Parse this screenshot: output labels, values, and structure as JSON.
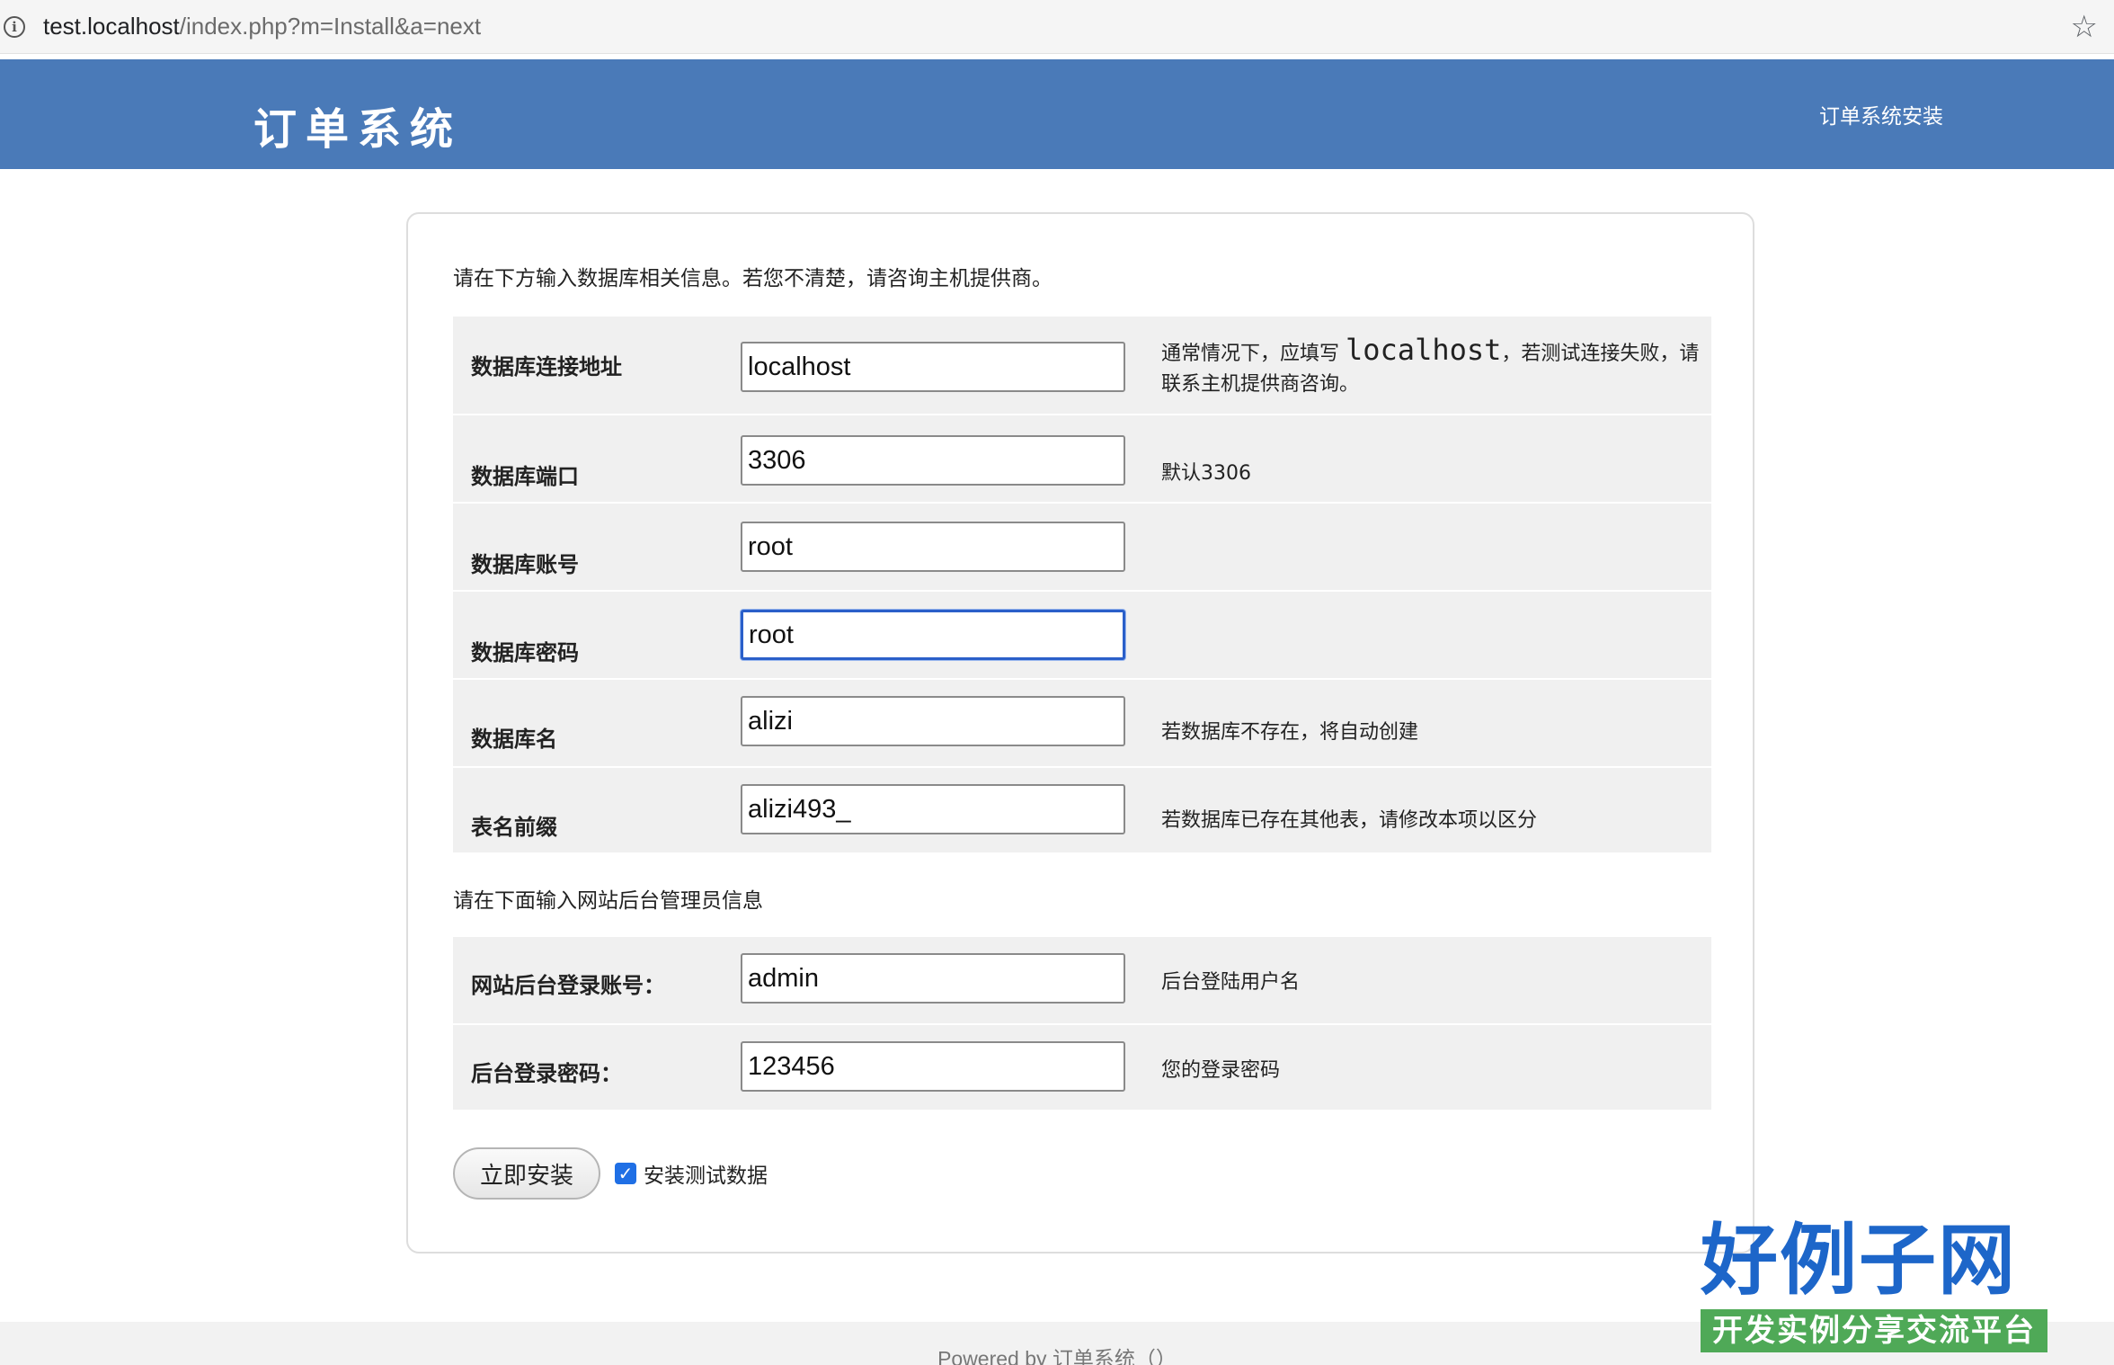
{
  "browser": {
    "url_host": "test.localhost",
    "url_path": "/index.php?m=Install&a=next"
  },
  "header": {
    "logo": "订单系统",
    "nav_link": "订单系统安装"
  },
  "intro": "请在下方输入数据库相关信息。若您不清楚，请咨询主机提供商。",
  "db_fields": [
    {
      "label": "数据库连接地址",
      "value": "localhost",
      "hint_pre": "通常情况下，应填写 ",
      "hint_mono": "localhost",
      "hint_post": "，若测试连接失败，请联系主机提供商咨询。"
    },
    {
      "label": "数据库端口",
      "value": "3306",
      "hint": "默认3306"
    },
    {
      "label": "数据库账号",
      "value": "root",
      "hint": ""
    },
    {
      "label": "数据库密码",
      "value": "root",
      "hint": ""
    },
    {
      "label": "数据库名",
      "value": "alizi",
      "hint": "若数据库不存在，将自动创建"
    },
    {
      "label": "表名前缀",
      "value": "alizi493_",
      "hint": "若数据库已存在其他表，请修改本项以区分"
    }
  ],
  "admin_section": "请在下面输入网站后台管理员信息",
  "admin_fields": [
    {
      "label": "网站后台登录账号：",
      "value": "admin",
      "hint": "后台登陆用户名"
    },
    {
      "label": "后台登录密码：",
      "value": "123456",
      "hint": "您的登录密码"
    }
  ],
  "install_button": "立即安装",
  "test_data": {
    "label": "安装测试数据",
    "checked": true
  },
  "footer": "Powered by 订单系统（）",
  "brand": {
    "name": "好例子网",
    "tagline": "开发实例分享交流平台"
  },
  "colors": {
    "header": "#4a7ab8",
    "checkbox": "#1f6fe5",
    "brand_name": "#1d66c9",
    "brand_tag": "#4fa957"
  }
}
